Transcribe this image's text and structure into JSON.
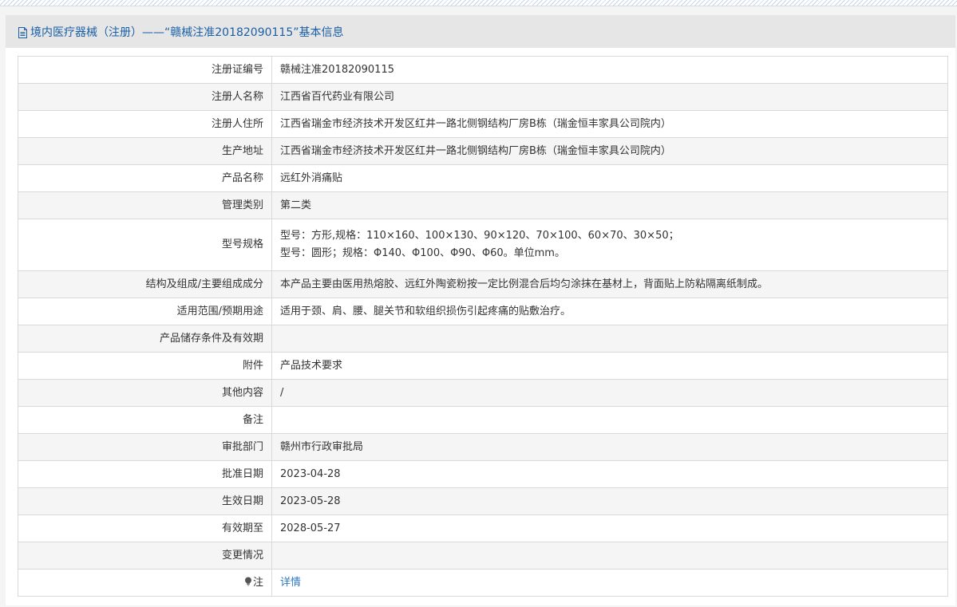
{
  "header": {
    "title": "境内医疗器械（注册）——“赣械注准20182090115”基本信息",
    "icon": "document-icon"
  },
  "rows": [
    {
      "label": "注册证编号",
      "value": "赣械注准20182090115"
    },
    {
      "label": "注册人名称",
      "value": "江西省百代药业有限公司"
    },
    {
      "label": "注册人住所",
      "value": "江西省瑞金市经济技术开发区红井一路北侧钢结构厂房B栋（瑞金恒丰家具公司院内）"
    },
    {
      "label": "生产地址",
      "value": "江西省瑞金市经济技术开发区红井一路北侧钢结构厂房B栋（瑞金恒丰家具公司院内）"
    },
    {
      "label": "产品名称",
      "value": "远红外消痛贴"
    },
    {
      "label": "管理类别",
      "value": "第二类"
    },
    {
      "label": "型号规格",
      "value_lines": [
        "型号：方形,规格：110×160、100×130、90×120、70×100、60×70、30×50；",
        "型号：圆形；规格：Φ140、Φ100、Φ90、Φ60。单位mm。"
      ]
    },
    {
      "label": "结构及组成/主要组成成分",
      "value": "本产品主要由医用热熔胶、远红外陶瓷粉按一定比例混合后均匀涂抹在基材上，背面贴上防粘隔离纸制成。"
    },
    {
      "label": "适用范围/预期用途",
      "value": "适用于颈、肩、腰、腿关节和软组织损伤引起疼痛的贴敷治疗。"
    },
    {
      "label": "产品储存条件及有效期",
      "value": ""
    },
    {
      "label": "附件",
      "value": "产品技术要求"
    },
    {
      "label": "其他内容",
      "value": "/"
    },
    {
      "label": "备注",
      "value": ""
    },
    {
      "label": "审批部门",
      "value": "赣州市行政审批局"
    },
    {
      "label": "批准日期",
      "value": "2023-04-28"
    },
    {
      "label": "生效日期",
      "value": "2023-05-28"
    },
    {
      "label": "有效期至",
      "value": "2028-05-27"
    },
    {
      "label": "变更情况",
      "value": ""
    },
    {
      "label": "注",
      "value": "详情",
      "icon": "lightbulb-icon"
    }
  ],
  "colors": {
    "accent": "#1b5fa6",
    "link": "#2b78c2",
    "header_bg": "#e6e6e6",
    "alt_row": "#f5f5f5",
    "border": "#d9d9d9"
  }
}
